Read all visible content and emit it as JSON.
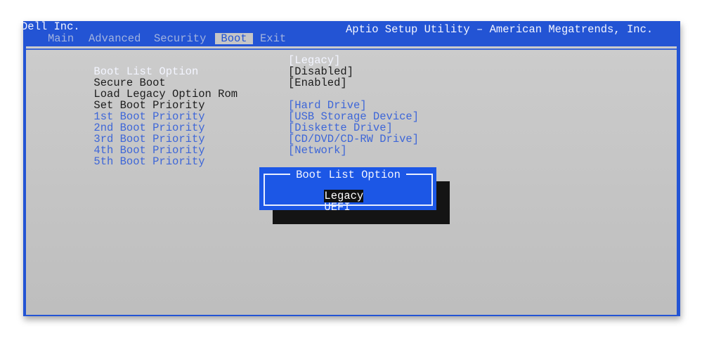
{
  "header": {
    "vendor": "Dell Inc.",
    "title": "Aptio Setup Utility – American Megatrends, Inc."
  },
  "tabs": [
    {
      "label": "Main",
      "selected": false
    },
    {
      "label": "Advanced",
      "selected": false
    },
    {
      "label": "Security",
      "selected": false
    },
    {
      "label": "Boot",
      "selected": true
    },
    {
      "label": "Exit",
      "selected": false
    }
  ],
  "boot_menu": {
    "items": [
      {
        "label": "Boot List Option",
        "value": "[Legacy]",
        "focused": true
      },
      {
        "label": "Secure Boot",
        "value": "[Disabled]"
      },
      {
        "label": "Load Legacy Option Rom",
        "value": "[Enabled]"
      },
      {
        "label": "Set Boot Priority"
      },
      {
        "label": "1st Boot Priority",
        "value": "[Hard Drive]"
      },
      {
        "label": "2nd Boot Priority",
        "value": "[USB Storage Device]"
      },
      {
        "label": "3rd Boot Priority",
        "value": "[Diskette Drive]"
      },
      {
        "label": "4th Boot Priority",
        "value": "[CD/DVD/CD-RW Drive]"
      },
      {
        "label": "5th Boot Priority",
        "value": "[Network]"
      }
    ]
  },
  "popup": {
    "title": "Boot List Option",
    "options": [
      {
        "label": "Legacy",
        "highlighted": true
      },
      {
        "label": "UEFI",
        "highlighted": false
      }
    ]
  },
  "colors": {
    "header_blue": "#2354d4",
    "panel_gray": "#c8c8c8",
    "tab_inactive": "#a2b3df",
    "item_priority_blue": "#3d66d8",
    "popup_blue": "#1c57e6",
    "highlight_black": "#101010",
    "text_white": "#f3f5ff"
  }
}
